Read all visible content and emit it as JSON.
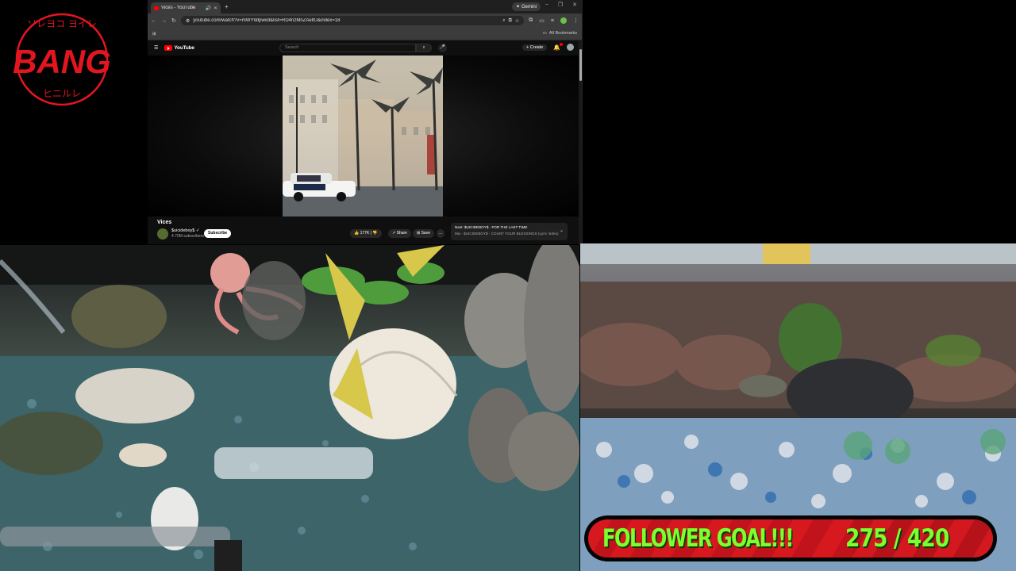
{
  "overlay": {
    "logo_text": "BANG",
    "logo_arc_top": "ソレヨコ ヨイレ",
    "logo_arc_bottom": "ヒニルレ",
    "logo_color": "#e3161f"
  },
  "browser": {
    "tab_title": "Vices - YouTube",
    "gemini_label": "Gemini",
    "url": "youtube.com/watch?v=mWY9dpwxd&list=RD4nzMnZAeltU&index=18",
    "all_bookmarks": "All Bookmarks"
  },
  "youtube": {
    "logo_text": "YouTube",
    "search_placeholder": "Search",
    "create_label": "Create",
    "video": {
      "title": "Vices",
      "channel": "$uicideboy$",
      "subscribers": "4.70M subscribers",
      "subscribe_label": "Subscribe",
      "likes": "177K",
      "share_label": "Share",
      "save_label": "Save",
      "more_label": "...",
      "next_title": "Next: $UICIDEBOY$ - FOR THE LAST TIME",
      "next_mix": "Mix - $UICIDEBOY$ - COUNT YOUR BLESSINGS (Lyric Video)"
    }
  },
  "follower_goal": {
    "label": "FOLLOWER GOAL!!!",
    "current": 275,
    "target": 420,
    "count_text": "275 / 420",
    "text_color": "#7cff2e",
    "bar_color": "#d3181f"
  }
}
